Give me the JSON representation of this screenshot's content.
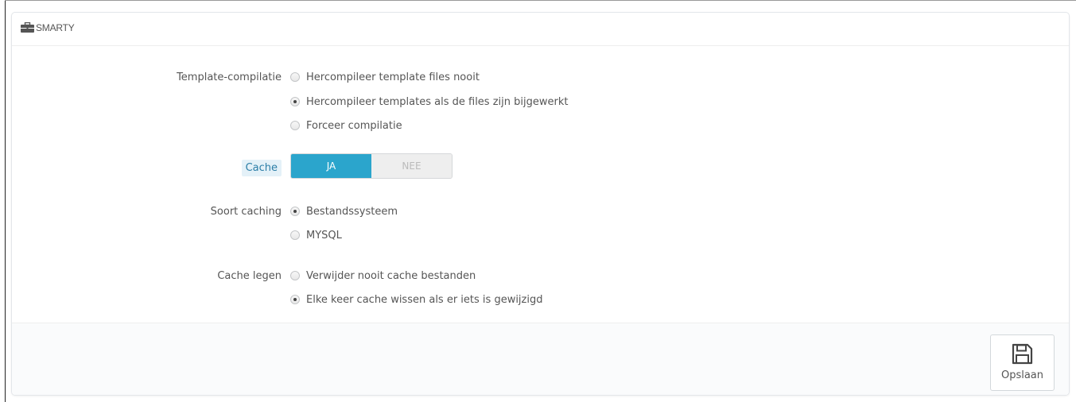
{
  "panel": {
    "title": "SMARTY",
    "heading_icon": "briefcase-icon"
  },
  "template_compilation": {
    "label": "Template-compilatie",
    "options": [
      {
        "label": "Hercompileer template files nooit",
        "checked": false
      },
      {
        "label": "Hercompileer templates als de files zijn bijgewerkt",
        "checked": true
      },
      {
        "label": "Forceer compilatie",
        "checked": false
      }
    ]
  },
  "cache": {
    "label": "Cache",
    "on_label": "JA",
    "off_label": "NEE",
    "value": "JA"
  },
  "caching_type": {
    "label": "Soort caching",
    "options": [
      {
        "label": "Bestandssysteem",
        "checked": true
      },
      {
        "label": "MYSQL",
        "checked": false
      }
    ]
  },
  "clear_cache": {
    "label": "Cache legen",
    "options": [
      {
        "label": "Verwijder nooit cache bestanden",
        "checked": false
      },
      {
        "label": "Elke keer cache wissen als er iets is gewijzigd",
        "checked": true
      }
    ]
  },
  "footer": {
    "save_label": "Opslaan",
    "save_icon": "floppy-disk-icon"
  },
  "colors": {
    "accent": "#2ba5cc",
    "cache_label_bg": "#e4f1f8",
    "cache_label_text": "#2c7ea7"
  }
}
